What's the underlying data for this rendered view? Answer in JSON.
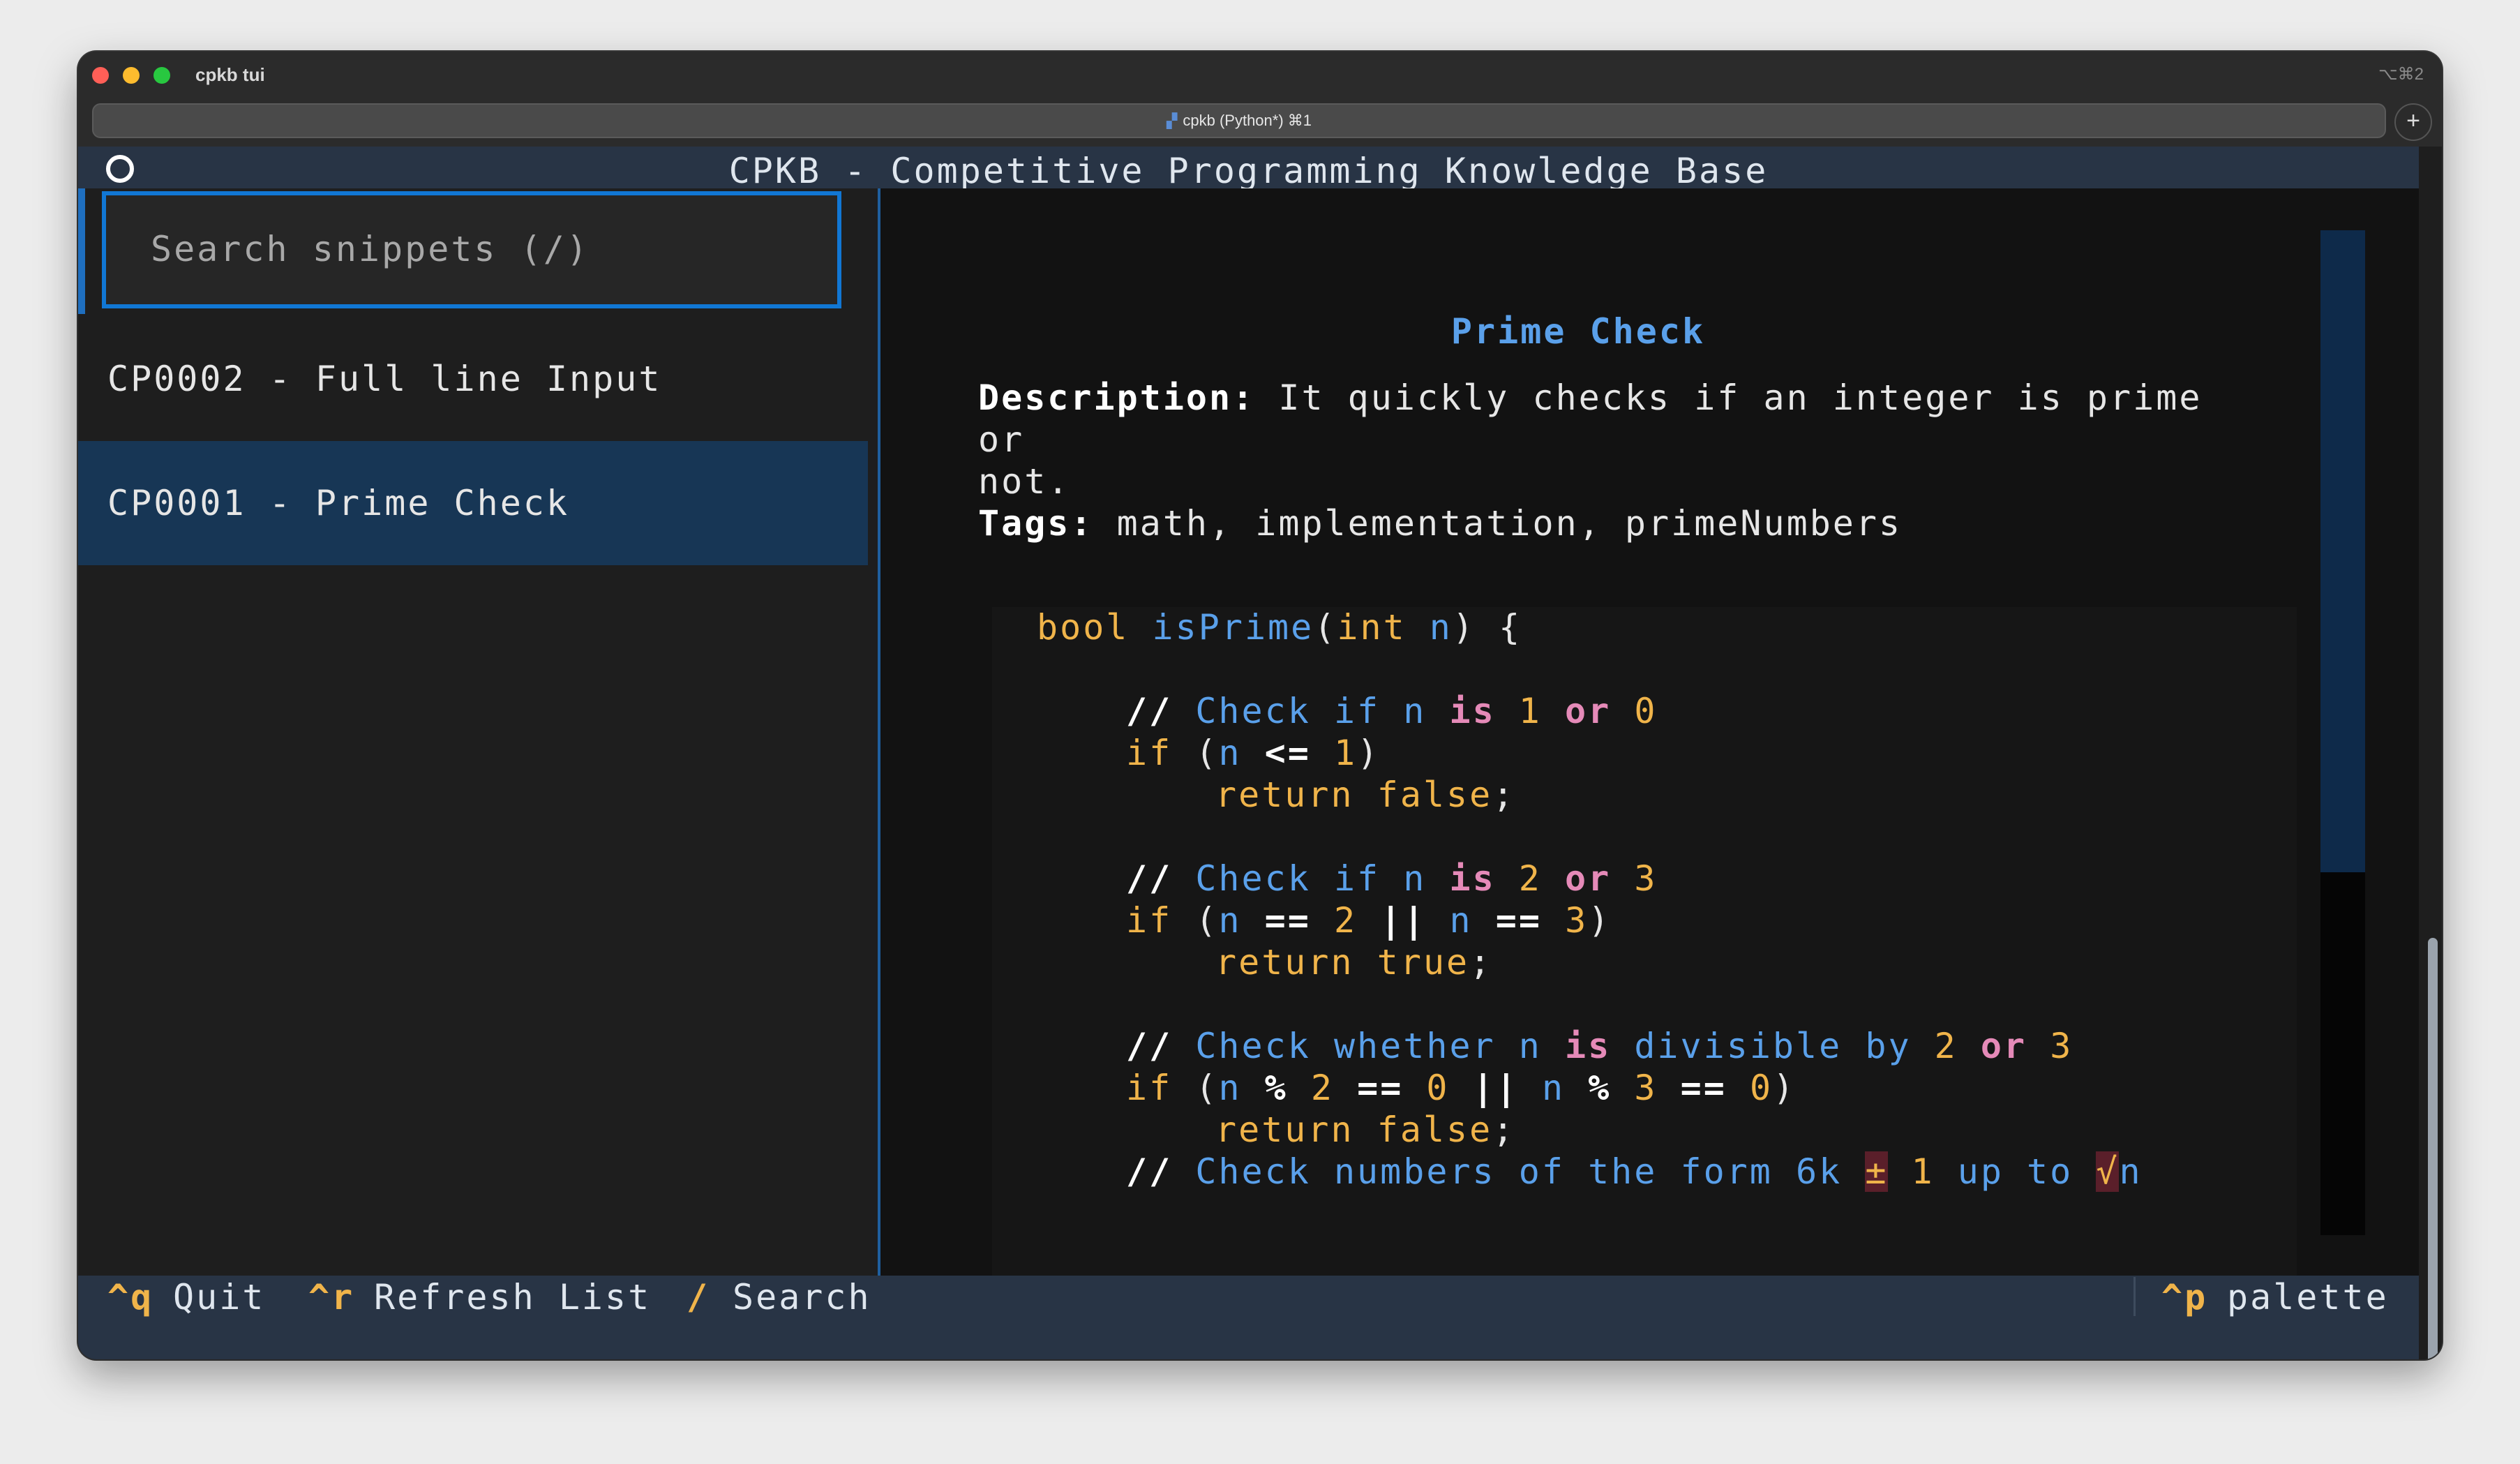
{
  "window": {
    "title": "cpkb tui",
    "shortcut": "⌥⌘2",
    "tab_label": "cpkb (Python*) ⌘1",
    "new_tab": "+"
  },
  "app": {
    "title": "CPKB - Competitive Programming Knowledge Base"
  },
  "sidebar": {
    "search_placeholder": "Search snippets (/)",
    "items": [
      {
        "label": "CP0002 - Full line Input",
        "selected": false
      },
      {
        "label": "CP0001 - Prime Check",
        "selected": true
      }
    ]
  },
  "detail": {
    "title": "Prime Check",
    "description_label": "Description:",
    "description_line1": "It quickly checks if an integer is prime or",
    "description_line2": "not.",
    "tags_label": "Tags:",
    "tags": "math, implementation, primeNumbers"
  },
  "code": {
    "l1_type": "bool",
    "l1_fn": "isPrime",
    "l1_open": "(",
    "l1_ptype": "int",
    "l1_param": "n",
    "l1_close": ") {",
    "c1_slash": "//",
    "c1_a": "Check if n",
    "c1_is": "is",
    "c1_n1": "1",
    "c1_or": "or",
    "c1_n2": "0",
    "if1_kw": "if",
    "if1_open": "(",
    "if1_var": "n",
    "if1_op": "<=",
    "if1_num": "1",
    "if1_close": ")",
    "ret1_kw": "return",
    "ret1_val": "false",
    "ret1_semi": ";",
    "c2_slash": "//",
    "c2_a": "Check if n",
    "c2_is": "is",
    "c2_n1": "2",
    "c2_or": "or",
    "c2_n2": "3",
    "if2_kw": "if",
    "if2_open": "(",
    "if2_var1": "n",
    "if2_op1": "==",
    "if2_num1": "2",
    "if2_or": "||",
    "if2_var2": "n",
    "if2_op2": "==",
    "if2_num2": "3",
    "if2_close": ")",
    "ret2_kw": "return",
    "ret2_val": "true",
    "ret2_semi": ";",
    "c3_slash": "//",
    "c3_a": "Check whether n",
    "c3_is": "is",
    "c3_b": "divisible by",
    "c3_n1": "2",
    "c3_or": "or",
    "c3_n2": "3",
    "if3_kw": "if",
    "if3_open": "(",
    "if3_var1": "n",
    "if3_mod1": "%",
    "if3_num1": "2",
    "if3_eq1": "==",
    "if3_zero1": "0",
    "if3_or": "||",
    "if3_var2": "n",
    "if3_mod2": "%",
    "if3_num2": "3",
    "if3_eq2": "==",
    "if3_zero2": "0",
    "if3_close": ")",
    "ret3_kw": "return",
    "ret3_val": "false",
    "ret3_semi": ";",
    "c4_slash": "//",
    "c4_a": "Check numbers of the form 6k",
    "c4_pm": "±",
    "c4_one": "1",
    "c4_b": "up to",
    "c4_sqrt": "√",
    "c4_n": "n"
  },
  "footer": {
    "quit_key": "^q",
    "quit_label": "Quit",
    "refresh_key": "^r",
    "refresh_label": "Refresh List",
    "search_key": "/",
    "search_label": "Search",
    "palette_key": "^p",
    "palette_label": "palette"
  },
  "colors": {
    "accent": "#1177d4",
    "selected_bg": "#173655",
    "header_bg": "#283445",
    "key_color": "#f0b44a",
    "heading_color": "#5aa0ea"
  },
  "icons": [
    "close-icon",
    "minimize-icon",
    "zoom-icon",
    "terminal-icon",
    "add-tab-icon",
    "status-circle-icon"
  ]
}
